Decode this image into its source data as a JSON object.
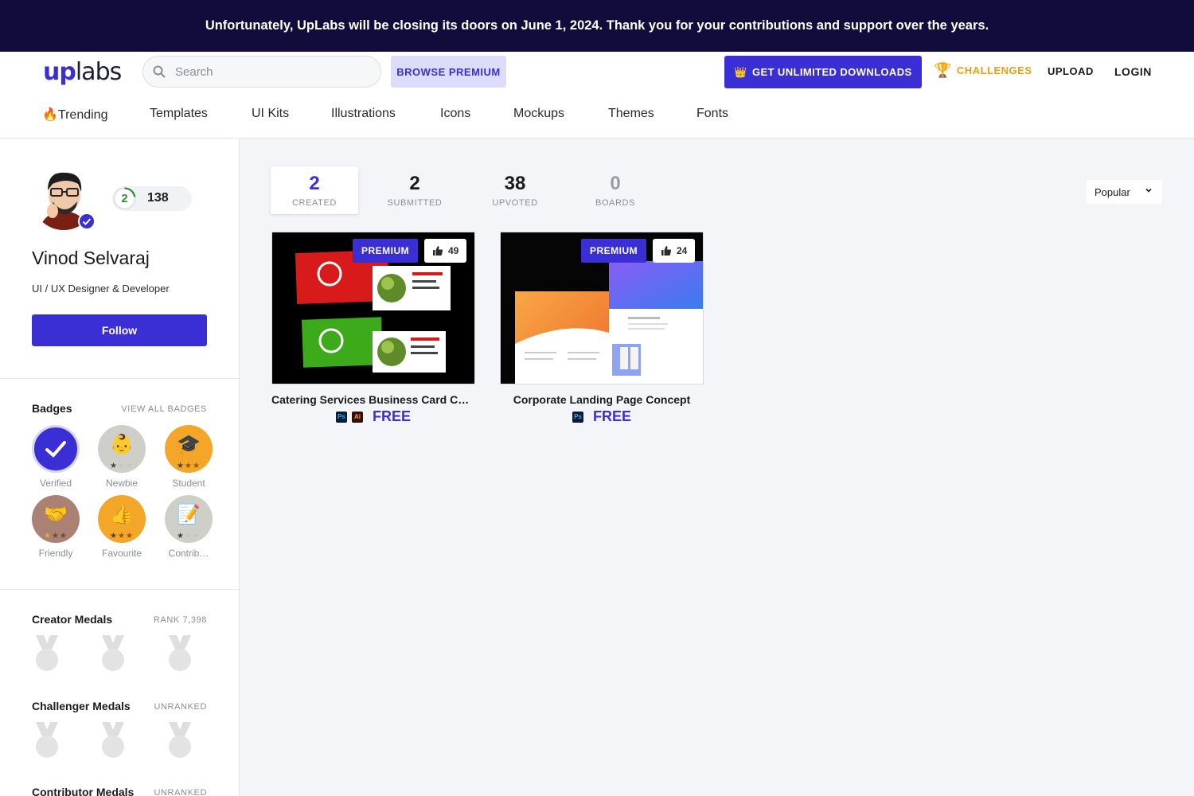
{
  "announcement": "Unfortunately, UpLabs will be closing its doors on June 1, 2024. Thank you for your contributions and support over the years.",
  "header": {
    "logo_up": "up",
    "logo_labs": "labs",
    "search_placeholder": "Search",
    "browse_premium": "BROWSE PREMIUM",
    "get_unlimited": "GET UNLIMITED DOWNLOADS",
    "challenges": "CHALLENGES",
    "upload": "UPLOAD",
    "login": "LOGIN"
  },
  "categories": [
    "🔥Trending",
    "Templates",
    "UI Kits",
    "Illustrations",
    "Icons",
    "Mockups",
    "Themes",
    "Fonts"
  ],
  "profile": {
    "level": "2",
    "points": "138",
    "name": "Vinod Selvaraj",
    "tagline": "UI / UX Designer & Developer",
    "follow": "Follow"
  },
  "badges": {
    "title": "Badges",
    "view_all": "VIEW ALL BADGES",
    "items": [
      {
        "label": "Verified",
        "icon": "check-icon"
      },
      {
        "label": "Newbie",
        "icon": "baby-icon"
      },
      {
        "label": "Student",
        "icon": "graduation-cap-icon"
      },
      {
        "label": "Friendly",
        "icon": "handshake-icon"
      },
      {
        "label": "Favourite",
        "icon": "thumbs-up-icon"
      },
      {
        "label": "Contrib…",
        "icon": "memo-icon"
      }
    ]
  },
  "creator_medals": {
    "title": "Creator Medals",
    "rank": "RANK 7,398"
  },
  "challenger_medals": {
    "title": "Challenger Medals",
    "rank": "UNRANKED"
  },
  "contributor_medals": {
    "title": "Contributor Medals",
    "rank": "UNRANKED"
  },
  "stats": [
    {
      "num": "2",
      "label": "CREATED"
    },
    {
      "num": "2",
      "label": "SUBMITTED"
    },
    {
      "num": "38",
      "label": "UPVOTED"
    },
    {
      "num": "0",
      "label": "BOARDS"
    }
  ],
  "sort": {
    "value": "Popular"
  },
  "cards": [
    {
      "title": "Catering Services Business Card Co…",
      "premium": "PREMIUM",
      "likes": "49",
      "tools": [
        "Ps",
        "Ai"
      ],
      "price": "FREE"
    },
    {
      "title": "Corporate Landing Page Concept",
      "premium": "PREMIUM",
      "likes": "24",
      "tools": [
        "Ps"
      ],
      "price": "FREE"
    }
  ],
  "colors": {
    "accent": "#3a2fd5",
    "banner": "#110c3b",
    "challenge": "#e7a20a"
  }
}
